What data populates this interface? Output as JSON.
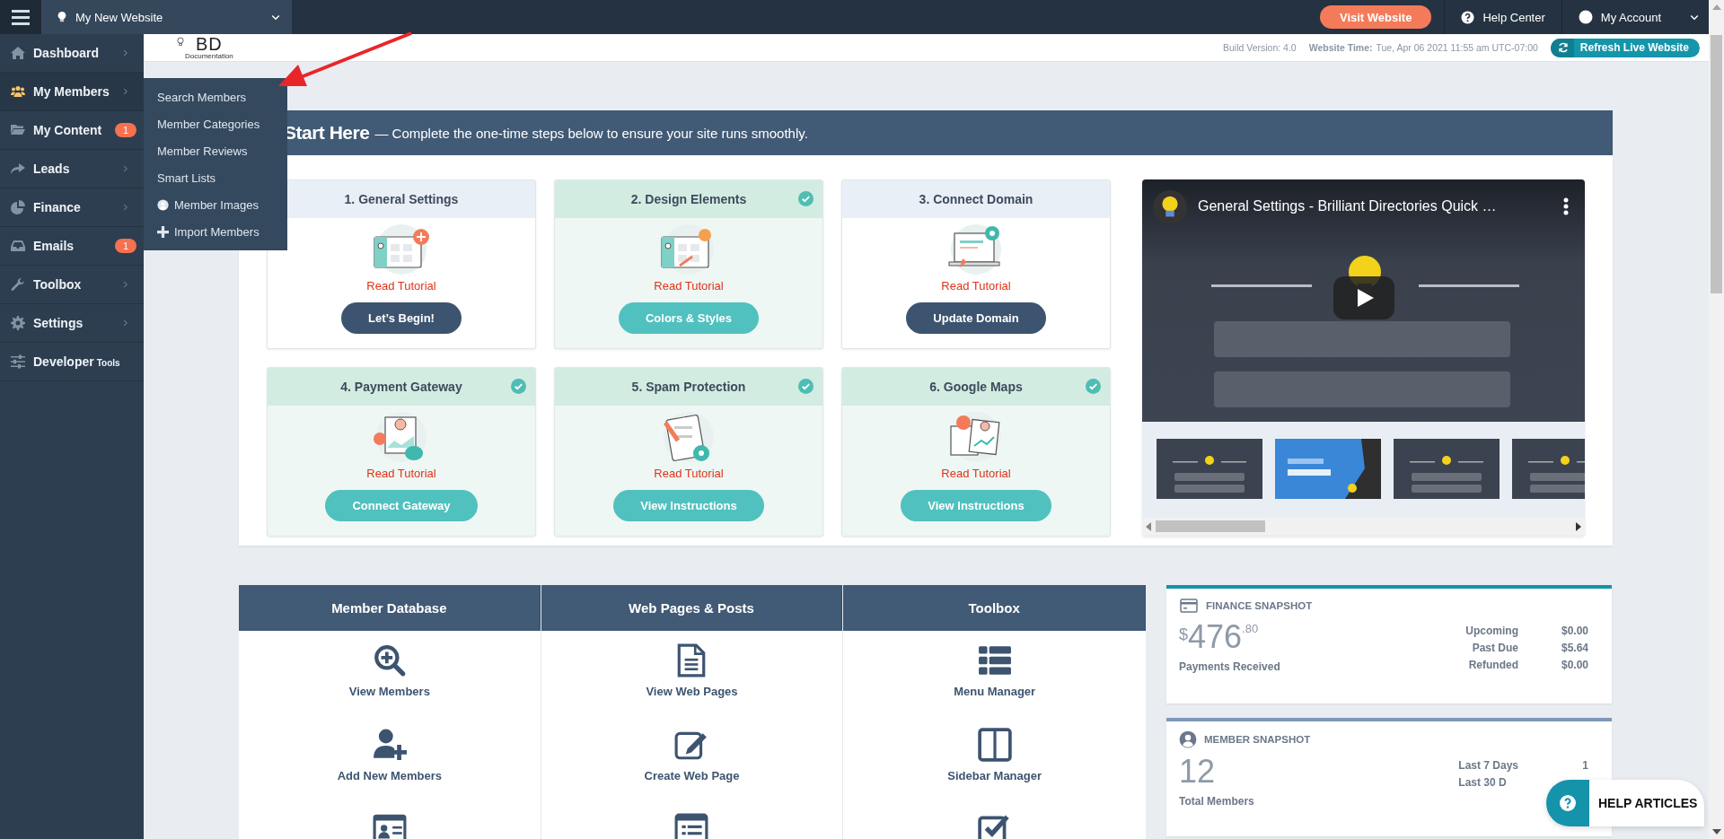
{
  "topbar": {
    "site_name": "My New Website",
    "visit_button": "Visit Website",
    "help": "Help Center",
    "account": "My Account"
  },
  "header": {
    "logo_text": "BD",
    "logo_subtitle": "Documentation",
    "build": "Build Version: 4.0",
    "time_label": "Website Time:",
    "time_value": "Tue, Apr 06 2021 11:55 am UTC-07:00",
    "refresh_button": "Refresh Live Website"
  },
  "sidebar": {
    "items": [
      {
        "label": "Dashboard",
        "kind": "menu",
        "expanded": false
      },
      {
        "label": "My Members",
        "kind": "menu",
        "expanded": true,
        "submenu": [
          "Search Members",
          "Member Categories",
          "Member Reviews",
          "Smart Lists",
          "Member Images",
          "Import Members"
        ]
      },
      {
        "label": "My Content",
        "kind": "menu",
        "expanded": false,
        "badge": "1"
      },
      {
        "label": "Leads",
        "kind": "menu",
        "expanded": false
      },
      {
        "label": "Finance",
        "kind": "menu",
        "expanded": false
      },
      {
        "label": "Emails",
        "kind": "menu",
        "expanded": false,
        "badge": "1"
      },
      {
        "label": "Toolbox",
        "kind": "menu",
        "expanded": false
      },
      {
        "label": "Settings",
        "kind": "menu",
        "expanded": false
      },
      {
        "label": "Developer",
        "suffix": "Tools",
        "kind": "link",
        "expanded": false
      }
    ]
  },
  "start": {
    "title": "Start Here",
    "subtitle": "— Complete the one-time steps below to ensure your site runs smoothly.",
    "steps": [
      {
        "title": "1. General Settings",
        "completed": false,
        "link": "Read Tutorial",
        "button": "Let’s Begin!"
      },
      {
        "title": "2. Design Elements",
        "completed": true,
        "link": "Read Tutorial",
        "button": "Colors & Styles"
      },
      {
        "title": "3. Connect Domain",
        "completed": false,
        "link": "Read Tutorial",
        "button": "Update Domain"
      },
      {
        "title": "4. Payment Gateway",
        "completed": true,
        "link": "Read Tutorial",
        "button": "Connect Gateway"
      },
      {
        "title": "5. Spam Protection",
        "completed": true,
        "link": "Read Tutorial",
        "button": "View Instructions"
      },
      {
        "title": "6. Google Maps",
        "completed": true,
        "link": "Read Tutorial",
        "button": "View Instructions"
      }
    ],
    "video": {
      "title": "General Settings - Brilliant Directories Quick …"
    }
  },
  "quick_links": [
    {
      "title": "Member Database",
      "items": [
        "View Members",
        "Add New Members"
      ]
    },
    {
      "title": "Web Pages & Posts",
      "items": [
        "View Web Pages",
        "Create Web Page"
      ]
    },
    {
      "title": "Toolbox",
      "items": [
        "Menu Manager",
        "Sidebar Manager"
      ]
    }
  ],
  "snapshots": [
    {
      "kind": "finance",
      "title": "FINANCE SNAPSHOT",
      "currency": "$",
      "amount": "476",
      "cents": ".80",
      "label": "Payments Received",
      "rows": [
        {
          "label": "Upcoming",
          "value": "$0.00"
        },
        {
          "label": "Past Due",
          "value": "$5.64"
        },
        {
          "label": "Refunded",
          "value": "$0.00"
        }
      ]
    },
    {
      "kind": "members",
      "title": "MEMBER SNAPSHOT",
      "amount": "12",
      "label": "Total Members",
      "rows": [
        {
          "label": "Last 7 Days",
          "value": "1"
        },
        {
          "label": "Last 30 D"
        }
      ]
    }
  ],
  "help_button": "HELP ARTICLES"
}
